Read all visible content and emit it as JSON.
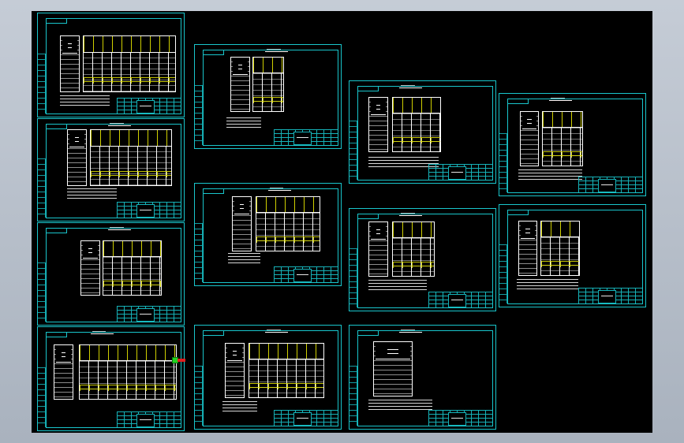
{
  "app": {
    "name": "",
    "canvas_background": "#000000",
    "frame_color": "#19c6cc",
    "table_line_color": "#ffffff",
    "highlight_color": "#e6e600",
    "grip_color": "#21d421"
  },
  "drawing_sheets": [
    {
      "id": "sheet-1"
    },
    {
      "id": "sheet-2"
    },
    {
      "id": "sheet-3"
    },
    {
      "id": "sheet-4"
    },
    {
      "id": "sheet-5"
    },
    {
      "id": "sheet-6"
    },
    {
      "id": "sheet-7"
    },
    {
      "id": "sheet-8"
    },
    {
      "id": "sheet-9"
    },
    {
      "id": "sheet-10"
    },
    {
      "id": "sheet-11"
    },
    {
      "id": "sheet-12"
    }
  ],
  "selection": {
    "grip_icon": "square-grip-icon",
    "state": "selected"
  }
}
